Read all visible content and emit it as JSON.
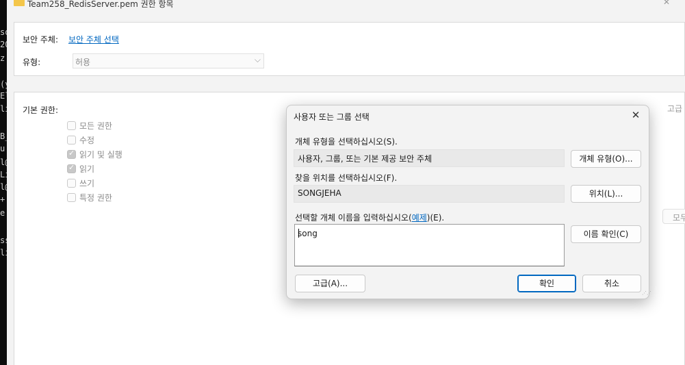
{
  "background": {
    "terminal_lines": [
      "so",
      "20",
      "z",
      "(y",
      "El",
      "li",
      "B_",
      "u",
      "l@",
      "Li",
      "l@",
      "+",
      "e",
      "ss",
      "li"
    ],
    "window_title": "Team258_RedisServer.pem 권한 항목",
    "principal_label": "보안 주체:",
    "principal_link": "보안 주체 선택",
    "type_label": "유형:",
    "type_value": "허용",
    "basic_perms_label": "기본 권한:",
    "permissions": [
      {
        "label": "모든 권한",
        "checked": false
      },
      {
        "label": "수정",
        "checked": false
      },
      {
        "label": "읽기 및 실행",
        "checked": true
      },
      {
        "label": "읽기",
        "checked": true
      },
      {
        "label": "쓰기",
        "checked": false
      },
      {
        "label": "특정 권한",
        "checked": false
      }
    ],
    "advanced_link": "고급",
    "clear_all_button": "모두"
  },
  "dialog": {
    "title": "사용자 또는 그룹 선택",
    "object_type_label": "개체 유형을 선택하십시오(S).",
    "object_type_value": "사용자, 그룹, 또는 기본 제공 보안 주체",
    "object_type_button": "개체 유형(O)...",
    "location_label": "찾을 위치를 선택하십시오(F).",
    "location_value": "SONGJEHA",
    "location_button": "위치(L)...",
    "name_label_prefix": "선택할 개체 이름을 입력하십시오(",
    "name_label_example": "예제",
    "name_label_suffix": ")(E).",
    "name_input_value": "song",
    "check_names_button": "이름 확인(C)",
    "advanced_button": "고급(A)...",
    "ok_button": "확인",
    "cancel_button": "취소"
  }
}
